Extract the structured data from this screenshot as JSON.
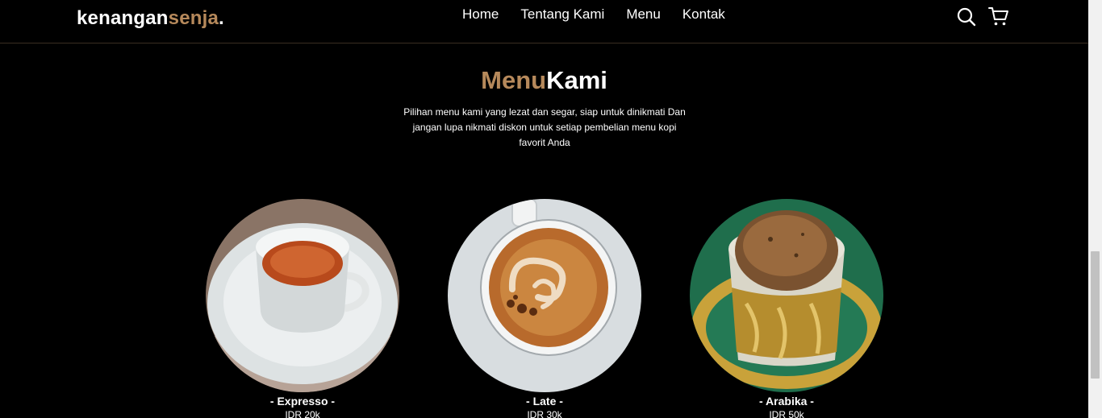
{
  "navbar": {
    "logo_main": "kenangan",
    "logo_accent": "senja",
    "logo_dot": ".",
    "links": [
      "Home",
      "Tentang Kami",
      "Menu",
      "Kontak"
    ],
    "icons": [
      "search-icon",
      "cart-icon"
    ]
  },
  "section": {
    "title_accent": "Menu",
    "title_main": "Kami",
    "description": "Pilihan menu kami yang lezat dan segar, siap untuk dinikmati Dan jangan lupa nikmati diskon untuk setiap pembelian menu kopi favorit Anda"
  },
  "menu_items": [
    {
      "name": "- Expresso -",
      "price": "IDR 20k"
    },
    {
      "name": "- Late -",
      "price": "IDR 30k"
    },
    {
      "name": "- Arabika -",
      "price": "IDR 50k"
    }
  ],
  "colors": {
    "accent": "#b6895b",
    "background": "#000000",
    "text": "#ffffff"
  }
}
